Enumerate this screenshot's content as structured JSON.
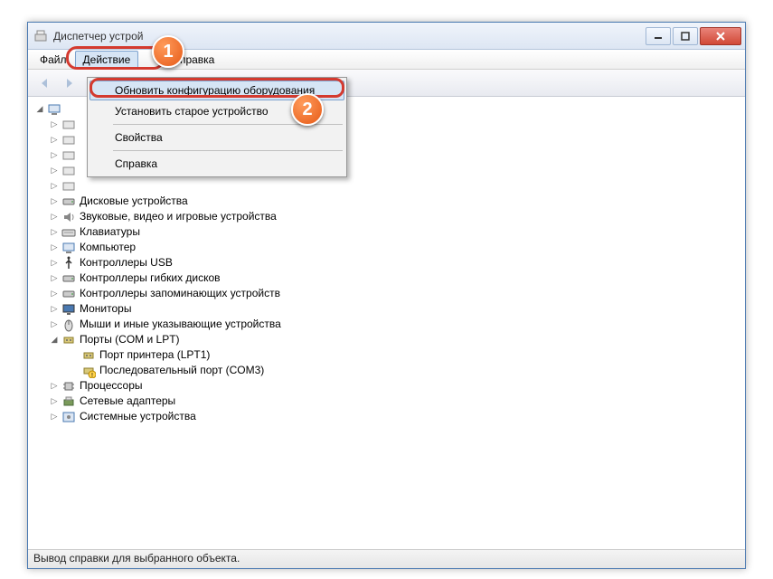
{
  "window": {
    "title": "Диспетчер устрой"
  },
  "menubar": {
    "file": "Файл",
    "action": "Действие",
    "help": "Справка"
  },
  "dropdown": {
    "scan": "Обновить конфигурацию оборудования",
    "legacy": "Установить старое устройство",
    "props": "Свойства",
    "help": "Справка"
  },
  "tree": {
    "root_hidden": "",
    "items": [
      {
        "label": "",
        "hidden_by_menu": true
      },
      {
        "label": "",
        "hidden_by_menu": true
      },
      {
        "label": "",
        "hidden_by_menu": true
      },
      {
        "label": "",
        "hidden_by_menu": true
      },
      {
        "label": "",
        "hidden_by_menu": true
      },
      {
        "label": "Дисковые устройства"
      },
      {
        "label": "Звуковые, видео и игровые устройства"
      },
      {
        "label": "Клавиатуры"
      },
      {
        "label": "Компьютер"
      },
      {
        "label": "Контроллеры USB"
      },
      {
        "label": "Контроллеры гибких дисков"
      },
      {
        "label": "Контроллеры запоминающих устройств"
      },
      {
        "label": "Мониторы"
      },
      {
        "label": "Мыши и иные указывающие устройства"
      },
      {
        "label": "Порты (COM и LPT)",
        "expanded": true,
        "children": [
          {
            "label": "Порт принтера (LPT1)"
          },
          {
            "label": "Последовательный порт (COM3)",
            "warning": true
          }
        ]
      },
      {
        "label": "Процессоры"
      },
      {
        "label": "Сетевые адаптеры"
      },
      {
        "label": "Системные устройства"
      }
    ]
  },
  "status": "Вывод справки для выбранного объекта.",
  "callouts": {
    "one": "1",
    "two": "2"
  }
}
